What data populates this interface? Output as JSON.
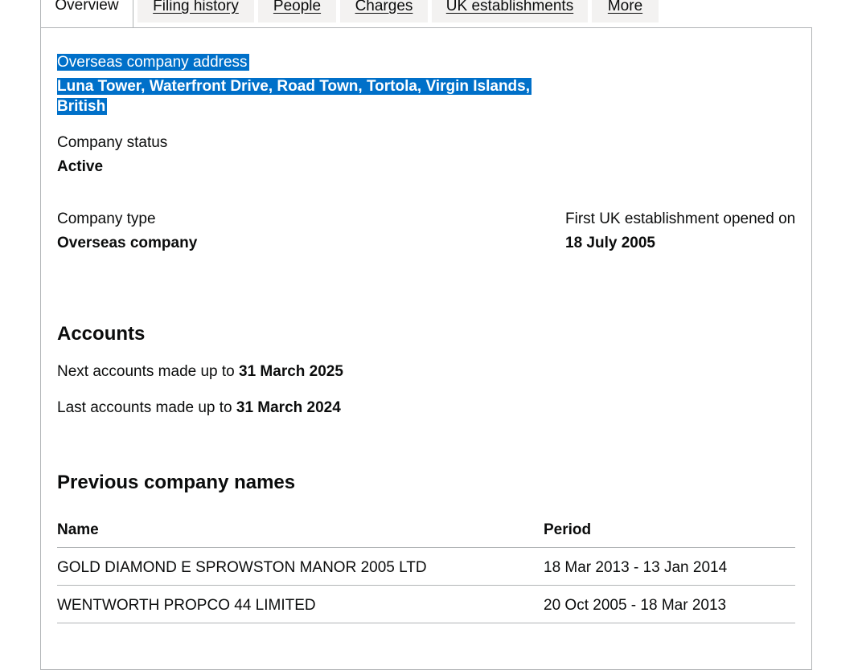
{
  "tabs": [
    {
      "label": "Overview",
      "active": true
    },
    {
      "label": "Filing history"
    },
    {
      "label": "People"
    },
    {
      "label": "Charges"
    },
    {
      "label": "UK establishments"
    },
    {
      "label": "More"
    }
  ],
  "overview": {
    "address_label": "Overseas company address",
    "address_line1": "Luna Tower, Waterfront Drive, Road Town, Tortola, Virgin Islands,",
    "address_line2": "British",
    "status_label": "Company status",
    "status_value": "Active",
    "type_label": "Company type",
    "type_value": "Overseas company",
    "first_uk_label": "First UK establishment opened on",
    "first_uk_value": "18 July 2005"
  },
  "accounts": {
    "heading": "Accounts",
    "next_prefix": "Next accounts made up to ",
    "next_date": "31 March 2025",
    "last_prefix": "Last accounts made up to ",
    "last_date": "31 March 2024"
  },
  "previous_names": {
    "heading": "Previous company names",
    "columns": [
      "Name",
      "Period"
    ],
    "rows": [
      {
        "name": "GOLD DIAMOND E SPROWSTON MANOR 2005 LTD",
        "period": "18 Mar 2013 - 13 Jan 2014"
      },
      {
        "name": "WENTWORTH PROPCO 44 LIMITED",
        "period": "20 Oct 2005 - 18 Mar 2013"
      }
    ]
  },
  "colors": {
    "highlight": "#0070c9",
    "border": "#b1b4b6",
    "tab_bg": "#f3f2f1"
  }
}
